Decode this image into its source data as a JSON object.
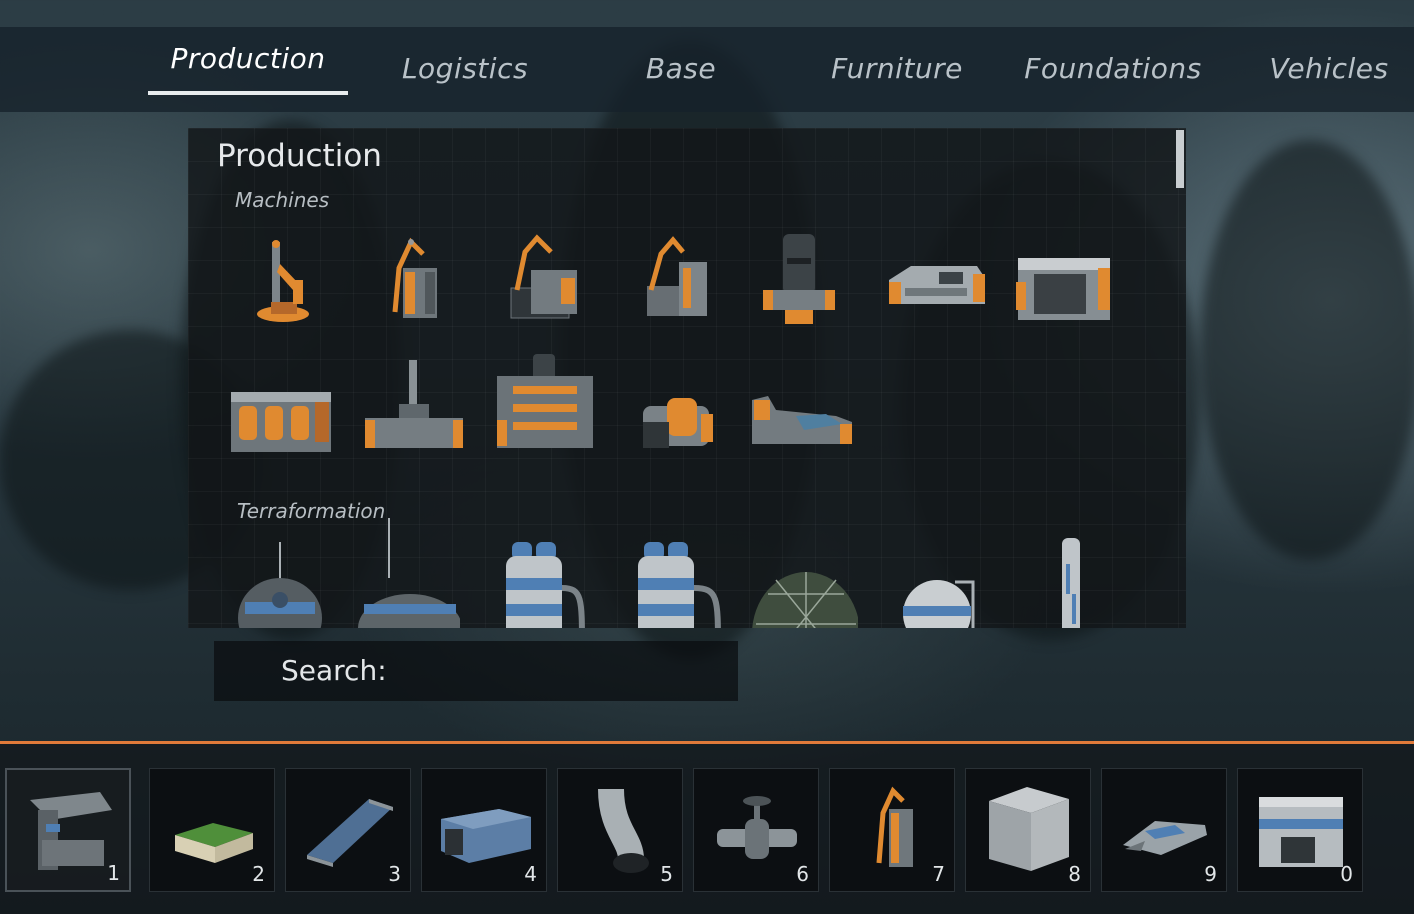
{
  "tabs": [
    {
      "label": "Production",
      "active": true
    },
    {
      "label": "Logistics",
      "active": false
    },
    {
      "label": "Base",
      "active": false
    },
    {
      "label": "Furniture",
      "active": false
    },
    {
      "label": "Foundations",
      "active": false
    },
    {
      "label": "Vehicles",
      "active": false
    }
  ],
  "panel": {
    "title": "Production",
    "sections": [
      {
        "label": "Machines",
        "items": [
          "robot-arm-icon",
          "assembler-icon",
          "assembler-tower-icon",
          "assembler-ramp-icon",
          "pump-machine-icon",
          "furnace-icon",
          "large-factory-icon",
          "triple-smelter-icon",
          "refinery-icon",
          "large-refinery-icon",
          "generator-icon",
          "crusher-icon"
        ]
      },
      {
        "label": "Terraformation",
        "items": [
          "antenna-dome-icon",
          "antenna-tank-icon",
          "tank-8-icon",
          "tank-6-icon",
          "dome-icon",
          "sphere-tank-icon",
          "pillar-icon"
        ]
      }
    ]
  },
  "search": {
    "label": "Search:",
    "value": ""
  },
  "hotbar": [
    {
      "number": "1",
      "icon": "build-tool-icon",
      "selected": true
    },
    {
      "number": "2",
      "icon": "planter-icon",
      "selected": false
    },
    {
      "number": "3",
      "icon": "conveyor-icon",
      "selected": false
    },
    {
      "number": "4",
      "icon": "container-icon",
      "selected": false
    },
    {
      "number": "5",
      "icon": "pipe-elbow-icon",
      "selected": false
    },
    {
      "number": "6",
      "icon": "valve-icon",
      "selected": false
    },
    {
      "number": "7",
      "icon": "assembler-icon",
      "selected": false
    },
    {
      "number": "8",
      "icon": "foundation-block-icon",
      "selected": false
    },
    {
      "number": "9",
      "icon": "ship-icon",
      "selected": false
    },
    {
      "number": "0",
      "icon": "habitat-module-icon",
      "selected": false
    }
  ],
  "colors": {
    "accent": "#e07a3a",
    "machine_orange": "#e08a30",
    "terra_blue": "#4f7fb4",
    "metal": "#8c949a"
  }
}
